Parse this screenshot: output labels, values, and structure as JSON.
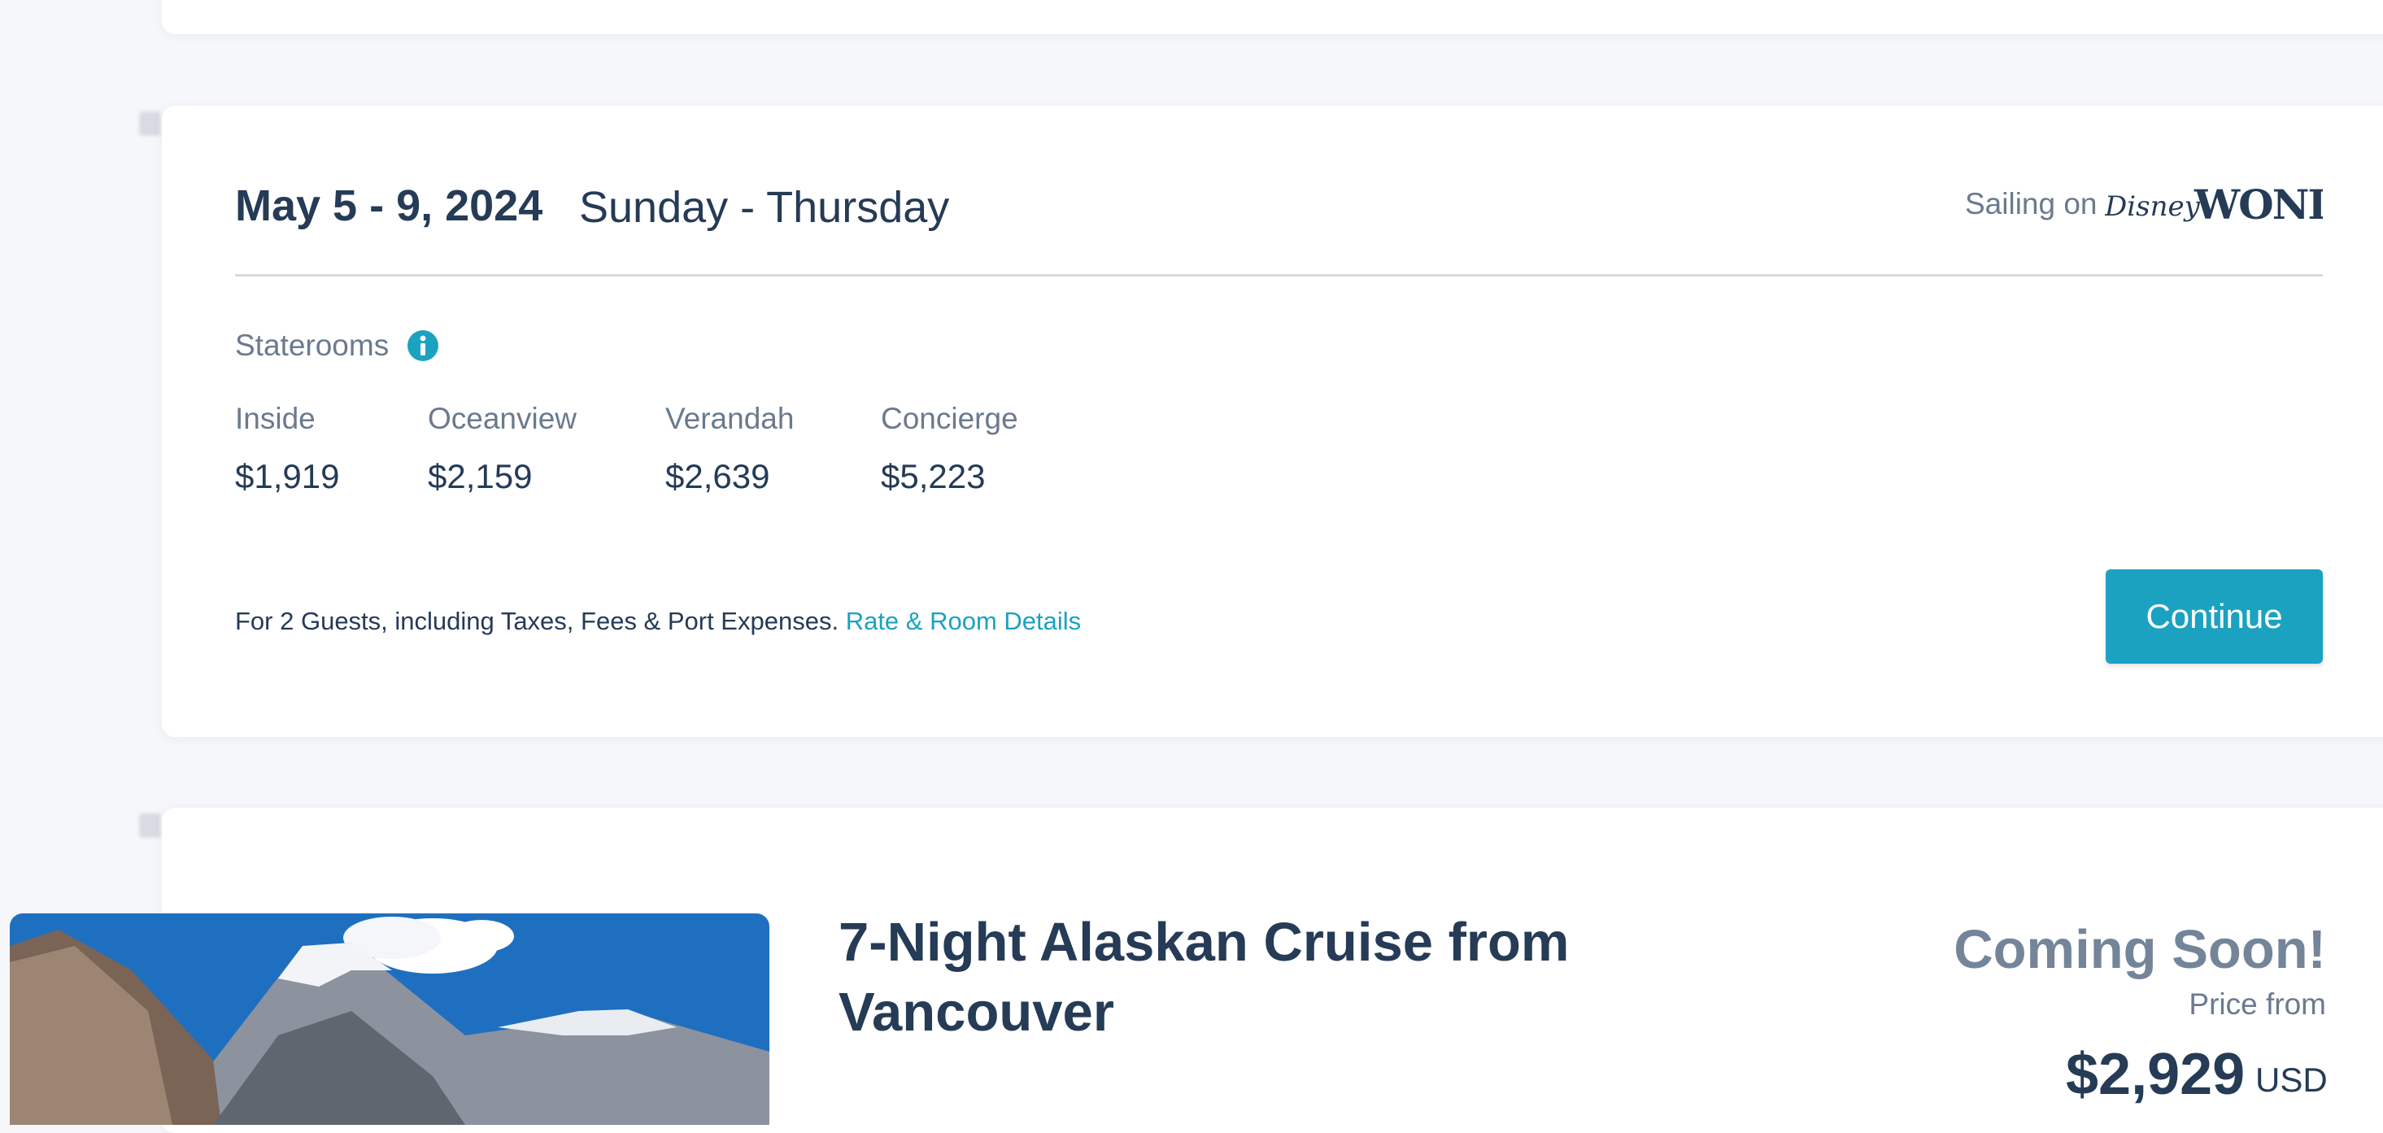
{
  "sailing_card": {
    "date_range": "May 5 - 9, 2024",
    "days": "Sunday - Thursday",
    "sailing_prefix": "Sailing on",
    "ship_logo_text": "Disney WONDER",
    "staterooms_label": "Staterooms",
    "rooms": [
      {
        "label": "Inside",
        "price": "$1,919"
      },
      {
        "label": "Oceanview",
        "price": "$2,159"
      },
      {
        "label": "Verandah",
        "price": "$2,639"
      },
      {
        "label": "Concierge",
        "price": "$5,223"
      }
    ],
    "footnote": "For 2 Guests, including Taxes, Fees & Port Expenses.",
    "details_link": "Rate & Room Details",
    "continue_label": "Continue"
  },
  "cruise_card": {
    "title": "7-Night Alaskan Cruise from Vancouver",
    "status": "Coming Soon!",
    "price_from_label": "Price from",
    "price": "$2,929",
    "currency": "USD"
  },
  "colors": {
    "accent": "#1ba2c1",
    "text_dark": "#253b56",
    "text_muted": "#6b7a8e",
    "background": "#f6f7fa"
  }
}
